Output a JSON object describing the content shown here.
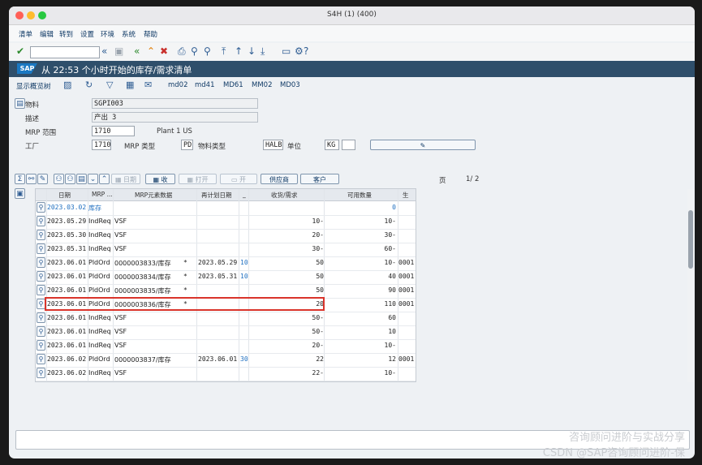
{
  "window": {
    "title": "S4H (1) (400)"
  },
  "menu": [
    "清单",
    "编辑",
    "转到",
    "设置",
    "环境",
    "系统",
    "帮助"
  ],
  "header": {
    "logo": "SAP",
    "title": "从 22:53 个小时开始的库存/需求清单"
  },
  "app_toolbar": {
    "overview": "显示概览树",
    "md02": "md02",
    "md41": "md41",
    "md61": "MD61",
    "mm02": "MM02",
    "md03": "MD03"
  },
  "form": {
    "material_label": "物料",
    "material_value": "SGPI003",
    "desc_label": "描述",
    "desc_value": "产出 3",
    "mrp_area_label": "MRP 范围",
    "mrp_area_value": "1710",
    "mrp_area_text": "Plant 1 US",
    "plant_label": "工厂",
    "plant_value": "1710",
    "mrp_type_label": "MRP 类型",
    "mrp_type_value": "PD",
    "material_type_label": "物料类型",
    "material_type_value": "HALB",
    "unit_label": "单位",
    "unit_value": "KG",
    "unit_extra": ""
  },
  "grid_toolbar": {
    "date_btn": "日期",
    "receipt_btn": "收",
    "open_btn": "打开",
    "open2_btn": "开",
    "vendor_btn": "供应商",
    "customer_btn": "客户",
    "page_label": "页",
    "page_value": "1/ 2"
  },
  "grid": {
    "columns": [
      "日期",
      "MRP ...",
      "MRP元素数据",
      "再计划日期",
      "_",
      "收货/需求",
      "可用数量",
      "生"
    ],
    "rows": [
      {
        "date": "2023.03.02",
        "mrp": "库存",
        "data": "",
        "star": "",
        "resched": "",
        "exc": "",
        "qty": "",
        "avail": "0",
        "prod": ""
      },
      {
        "date": "2023.05.29",
        "mrp": "IndReq",
        "data": "VSF",
        "star": "",
        "resched": "",
        "exc": "",
        "qty": "10-",
        "avail": "10-",
        "prod": ""
      },
      {
        "date": "2023.05.30",
        "mrp": "IndReq",
        "data": "VSF",
        "star": "",
        "resched": "",
        "exc": "",
        "qty": "20-",
        "avail": "30-",
        "prod": ""
      },
      {
        "date": "2023.05.31",
        "mrp": "IndReq",
        "data": "VSF",
        "star": "",
        "resched": "",
        "exc": "",
        "qty": "30-",
        "avail": "60-",
        "prod": ""
      },
      {
        "date": "2023.06.01",
        "mrp": "PldOrd",
        "data": "0000003833/库存",
        "star": "*",
        "resched": "2023.05.29",
        "exc": "10",
        "qty": "50",
        "avail": "10-",
        "prod": "0001"
      },
      {
        "date": "2023.06.01",
        "mrp": "PldOrd",
        "data": "0000003834/库存",
        "star": "*",
        "resched": "2023.05.31",
        "exc": "10",
        "qty": "50",
        "avail": "40",
        "prod": "0001"
      },
      {
        "date": "2023.06.01",
        "mrp": "PldOrd",
        "data": "0000003835/库存",
        "star": "*",
        "resched": "",
        "exc": "",
        "qty": "50",
        "avail": "90",
        "prod": "0001"
      },
      {
        "date": "2023.06.01",
        "mrp": "PldOrd",
        "data": "0000003836/库存",
        "star": "*",
        "resched": "",
        "exc": "",
        "qty": "20",
        "avail": "110",
        "prod": "0001"
      },
      {
        "date": "2023.06.01",
        "mrp": "IndReq",
        "data": "VSF",
        "star": "",
        "resched": "",
        "exc": "",
        "qty": "50-",
        "avail": "60",
        "prod": ""
      },
      {
        "date": "2023.06.01",
        "mrp": "IndReq",
        "data": "VSF",
        "star": "",
        "resched": "",
        "exc": "",
        "qty": "50-",
        "avail": "10",
        "prod": ""
      },
      {
        "date": "2023.06.01",
        "mrp": "IndReq",
        "data": "VSF",
        "star": "",
        "resched": "",
        "exc": "",
        "qty": "20-",
        "avail": "10-",
        "prod": ""
      },
      {
        "date": "2023.06.02",
        "mrp": "PldOrd",
        "data": "0000003837/库存",
        "star": "",
        "resched": "2023.06.01",
        "exc": "30",
        "qty": "22",
        "avail": "12",
        "prod": "0001"
      },
      {
        "date": "2023.06.02",
        "mrp": "IndReq",
        "data": "VSF",
        "star": "",
        "resched": "",
        "exc": "",
        "qty": "22-",
        "avail": "10-",
        "prod": ""
      }
    ]
  },
  "watermark": {
    "line1": "咨询顾问进阶与实战分享",
    "line2": "CSDN @SAP咨询顾问进阶-保"
  },
  "colors": {
    "header_bg": "#2f4f6b",
    "link": "#1f6fc0",
    "highlight_border": "#d9342b"
  }
}
